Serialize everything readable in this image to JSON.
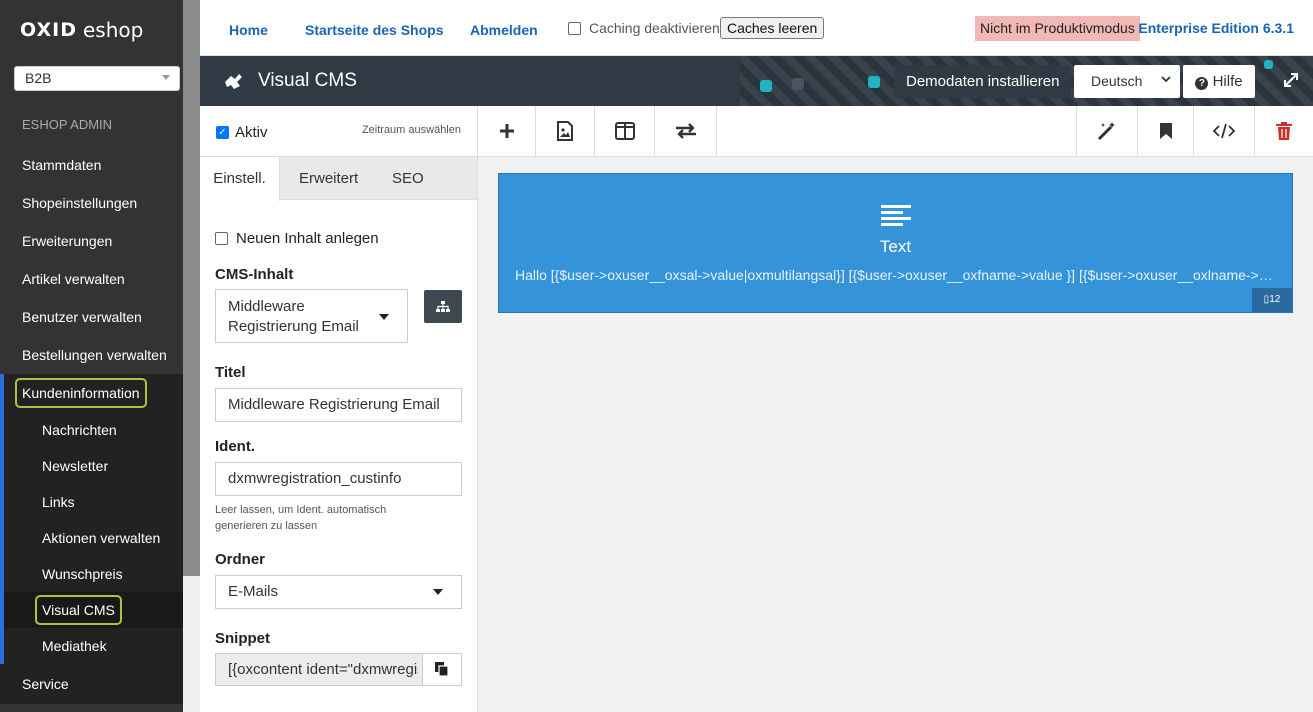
{
  "sidebar": {
    "logo_bold": "OXID",
    "logo_light": "eshop",
    "shop_select": "B2B",
    "admin_label": "ESHOP ADMIN",
    "items": [
      {
        "label": "Stammdaten"
      },
      {
        "label": "Shopeinstellungen"
      },
      {
        "label": "Erweiterungen"
      },
      {
        "label": "Artikel verwalten"
      },
      {
        "label": "Benutzer verwalten"
      },
      {
        "label": "Bestellungen verwalten"
      }
    ],
    "group_label": "Kundeninformation",
    "sub_items": [
      {
        "label": "Nachrichten"
      },
      {
        "label": "Newsletter"
      },
      {
        "label": "Links"
      },
      {
        "label": "Aktionen verwalten"
      },
      {
        "label": "Wunschpreis"
      },
      {
        "label": "Visual CMS"
      },
      {
        "label": "Mediathek"
      }
    ],
    "service_label": "Service"
  },
  "topbar": {
    "home": "Home",
    "shop_start": "Startseite des Shops",
    "logout": "Abmelden",
    "caching_label": "Caching deaktivieren",
    "clear_caches": "Caches leeren",
    "mode_badge": "Nicht im Produktivmodus",
    "edition": "Enterprise Edition 6.3.1"
  },
  "titlebar": {
    "title": "Visual CMS",
    "demo_button": "Demodaten installieren",
    "language": "Deutsch",
    "help_button": "Hilfe"
  },
  "panel": {
    "active_label": "Aktiv",
    "period_link": "Zeitraum auswählen",
    "tabs": [
      {
        "label": "Einstell."
      },
      {
        "label": "Erweitert"
      },
      {
        "label": "SEO"
      }
    ],
    "new_content_label": "Neuen Inhalt anlegen",
    "cms_content_label": "CMS-Inhalt",
    "cms_content_line1": "Middleware",
    "cms_content_line2": "Registrierung Email",
    "title_label": "Titel",
    "title_value": "Middleware Registrierung Email",
    "ident_label": "Ident.",
    "ident_value": "dxmwregistration_custinfo",
    "ident_hint": "Leer lassen, um Ident. automatisch generieren zu lassen",
    "folder_label": "Ordner",
    "folder_value": "E-Mails",
    "snippet_label": "Snippet",
    "snippet_value": "[{oxcontent ident=\"dxmwregistration_custinfo\"}]"
  },
  "widget": {
    "title": "Text",
    "body": "Hallo [{$user->oxuser__oxsal->value|oxmultilangsal}] [{$user->oxuser__oxfname->value }] [{$user->oxuser__oxlname->value }],",
    "width_badge": "12"
  },
  "colors": {
    "sidebar_bg": "#333333",
    "accent_blue": "#1a64b4",
    "highlight_green": "#a3c83f",
    "widget_blue": "#3593d9",
    "delete_red": "#c9302c",
    "titlebar_bg": "#303a44"
  }
}
